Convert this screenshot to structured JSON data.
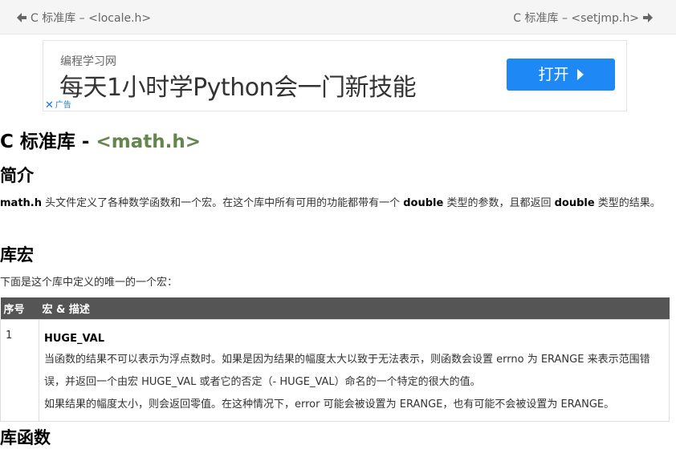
{
  "nav": {
    "prev_label": "C 标准库 – <locale.h>",
    "next_label": "C 标准库 – <setjmp.h>"
  },
  "ad": {
    "source": "编程学习网",
    "headline": "每天1小时学Python会一门新技能",
    "button_label": "打开",
    "ad_mark": "广告"
  },
  "page": {
    "title_prefix": "C 标准库 - ",
    "title_code": "<math.h>"
  },
  "intro": {
    "heading": "简介",
    "p_lib": "math.h",
    "p_part1": " 头文件定义了各种数学函数和一个宏。在这个库中所有可用的功能都带有一个 ",
    "p_type1": "double",
    "p_part2": " 类型的参数，且都返回 ",
    "p_type2": "double",
    "p_part3": " 类型的结果。"
  },
  "macros": {
    "heading": "库宏",
    "description": "下面是这个库中定义的唯一的一个宏：",
    "table": {
      "headers": [
        "序号",
        "宏 & 描述"
      ],
      "rows": [
        {
          "num": "1",
          "name": "HUGE_VAL",
          "desc1": "当函数的结果不可以表示为浮点数时。如果是因为结果的幅度太大以致于无法表示，则函数会设置 errno 为 ERANGE 来表示范围错误，并返回一个由宏 HUGE_VAL 或者它的否定（- HUGE_VAL）命名的一个特定的很大的值。",
          "desc2": "如果结果的幅度太小，则会返回零值。在这种情况下，error 可能会被设置为 ERANGE，也有可能不会被设置为 ERANGE。"
        }
      ]
    }
  },
  "functions": {
    "heading": "库函数"
  },
  "colors": {
    "accent": "#64854c",
    "table_header": "#555555",
    "ad_button": "#1e88f5"
  }
}
